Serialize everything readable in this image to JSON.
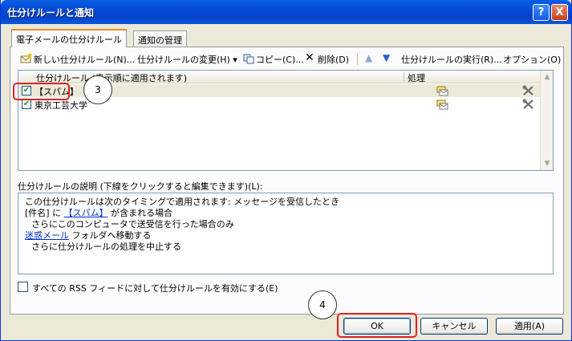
{
  "window": {
    "title": "仕分けルールと通知",
    "help_label": "?",
    "close_label": "X"
  },
  "tabs": [
    {
      "label": "電子メールの仕分けルール",
      "active": true
    },
    {
      "label": "通知の管理",
      "active": false
    }
  ],
  "toolbar": {
    "new_rule": "新しい仕分けルール(N)...",
    "change_rule": "仕分けルールの変更(H) ▾",
    "copy": "コピー(C)...",
    "delete": "削除(D)",
    "move_up_icon": "arrow-up",
    "move_down_icon": "arrow-down",
    "run_rules": "仕分けルールの実行(R)...",
    "options": "オプション(O)"
  },
  "rules_list": {
    "header_rule": "仕分けルール (表示順に適用されます)",
    "header_action": "処理",
    "rows": [
      {
        "label": "【スパム】",
        "checked": true,
        "selected": true
      },
      {
        "label": "東京工芸大学",
        "checked": true,
        "selected": false
      }
    ]
  },
  "description": {
    "label": "仕分けルールの説明 (下線をクリックすると編集できます)(L):",
    "line1": "この仕分けルールは次のタイミングで適用されます: メッセージを受信したとき",
    "line2_pre": "[件名] に ",
    "line2_link": "【スパム】",
    "line2_post": " が含まれる場合",
    "line3": "さらにこのコンピュータで送受信を行った場合のみ",
    "line4_link": "迷惑メール",
    "line4_post": " フォルダへ移動する",
    "line5": "さらに仕分けルールの処理を中止する"
  },
  "rss": {
    "label": "すべての RSS フィードに対して仕分けルールを有効にする(E)",
    "checked": false
  },
  "buttons": {
    "ok": "OK",
    "cancel": "キャンセル",
    "apply": "適用(A)"
  },
  "annotations": {
    "step3": "3",
    "step4": "4"
  },
  "colors": {
    "titlebar": "#0549d8",
    "dialog_bg": "#ece9d8",
    "link": "#0033cc",
    "highlight_box": "#e02020"
  }
}
